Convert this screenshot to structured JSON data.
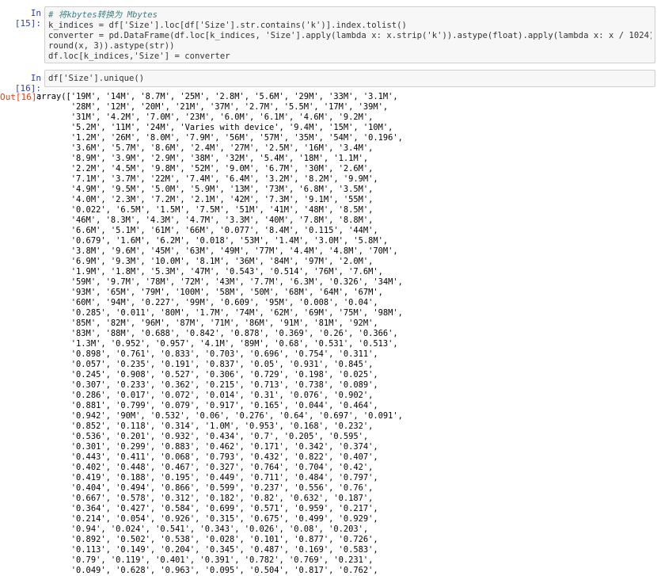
{
  "cells": {
    "c15": {
      "prompt": "In  [15]:",
      "lines": [
        {
          "text": "# 将kbytes转换为 Mbytes",
          "comment": true
        },
        {
          "text": "k_indices = df['Size'].loc[df['Size'].str.contains('k')].index.tolist()"
        },
        {
          "text": "converter = pd.DataFrame(df.loc[k_indices, 'Size'].apply(lambda x: x.strip('k')).astype(float).apply(lambda x: x / 1024).apply(lambda x:"
        },
        {
          "text": "round(x, 3)).astype(str))"
        },
        {
          "text": "df.loc[k_indices,'Size'] = converter"
        }
      ]
    },
    "c16": {
      "prompt": "In  [16]:",
      "code": "df['Size'].unique()",
      "out_prompt": "Out[16]:",
      "output_lines": [
        "array(['19M', '14M', '8.7M', '25M', '2.8M', '5.6M', '29M', '33M', '3.1M',",
        "       '28M', '12M', '20M', '21M', '37M', '2.7M', '5.5M', '17M', '39M',",
        "       '31M', '4.2M', '7.0M', '23M', '6.0M', '6.1M', '4.6M', '9.2M',",
        "       '5.2M', '11M', '24M', 'Varies with device', '9.4M', '15M', '10M',",
        "       '1.2M', '26M', '8.0M', '7.9M', '56M', '57M', '35M', '54M', '0.196',",
        "       '3.6M', '5.7M', '8.6M', '2.4M', '27M', '2.5M', '16M', '3.4M',",
        "       '8.9M', '3.9M', '2.9M', '38M', '32M', '5.4M', '18M', '1.1M',",
        "       '2.2M', '4.5M', '9.8M', '52M', '9.0M', '6.7M', '30M', '2.6M',",
        "       '7.1M', '3.7M', '22M', '7.4M', '6.4M', '3.2M', '8.2M', '9.9M',",
        "       '4.9M', '9.5M', '5.0M', '5.9M', '13M', '73M', '6.8M', '3.5M',",
        "       '4.0M', '2.3M', '7.2M', '2.1M', '42M', '7.3M', '9.1M', '55M',",
        "       '0.022', '6.5M', '1.5M', '7.5M', '51M', '41M', '48M', '8.5M',",
        "       '46M', '8.3M', '4.3M', '4.7M', '3.3M', '40M', '7.8M', '8.8M',",
        "       '6.6M', '5.1M', '61M', '66M', '0.077', '8.4M', '0.115', '44M',",
        "       '0.679', '1.6M', '6.2M', '0.018', '53M', '1.4M', '3.0M', '5.8M',",
        "       '3.8M', '9.6M', '45M', '63M', '49M', '77M', '4.4M', '4.8M', '70M',",
        "       '6.9M', '9.3M', '10.0M', '8.1M', '36M', '84M', '97M', '2.0M',",
        "       '1.9M', '1.8M', '5.3M', '47M', '0.543', '0.514', '76M', '7.6M',",
        "       '59M', '9.7M', '78M', '72M', '43M', '7.7M', '6.3M', '0.326', '34M',",
        "       '93M', '65M', '79M', '100M', '58M', '50M', '68M', '64M', '67M',",
        "       '60M', '94M', '0.227', '99M', '0.609', '95M', '0.008', '0.04',",
        "       '0.285', '0.011', '80M', '1.7M', '74M', '62M', '69M', '75M', '98M',",
        "       '85M', '82M', '96M', '87M', '71M', '86M', '91M', '81M', '92M',",
        "       '83M', '88M', '0.688', '0.842', '0.878', '0.369', '0.26', '0.366',",
        "       '1.3M', '0.952', '0.957', '4.1M', '89M', '0.68', '0.531', '0.513',",
        "       '0.898', '0.761', '0.833', '0.703', '0.696', '0.754', '0.311',",
        "       '0.057', '0.235', '0.191', '0.837', '0.05', '0.931', '0.845',",
        "       '0.245', '0.908', '0.527', '0.306', '0.729', '0.198', '0.025',",
        "       '0.307', '0.233', '0.362', '0.215', '0.713', '0.738', '0.089',",
        "       '0.286', '0.017', '0.072', '0.014', '0.31', '0.076', '0.902',",
        "       '0.881', '0.799', '0.079', '0.917', '0.165', '0.044', '0.464',",
        "       '0.942', '90M', '0.532', '0.06', '0.276', '0.64', '0.697', '0.091',",
        "       '0.852', '0.118', '0.314', '1.0M', '0.953', '0.168', '0.232',",
        "       '0.536', '0.201', '0.932', '0.434', '0.7', '0.205', '0.595',",
        "       '0.301', '0.299', '0.883', '0.462', '0.171', '0.342', '0.374',",
        "       '0.443', '0.411', '0.068', '0.793', '0.432', '0.822', '0.407',",
        "       '0.402', '0.448', '0.467', '0.327', '0.764', '0.704', '0.42',",
        "       '0.419', '0.188', '0.195', '0.449', '0.711', '0.484', '0.797',",
        "       '0.404', '0.494', '0.866', '0.599', '0.237', '0.556', '0.76',",
        "       '0.667', '0.578', '0.312', '0.182', '0.82', '0.632', '0.187',",
        "       '0.364', '0.427', '0.584', '0.699', '0.571', '0.959', '0.217',",
        "       '0.214', '0.054', '0.926', '0.315', '0.675', '0.499', '0.929',",
        "       '0.94', '0.024', '0.541', '0.343', '0.026', '0.08', '0.203',",
        "       '0.892', '0.502', '0.538', '0.028', '0.101', '0.877', '0.726',",
        "       '0.113', '0.149', '0.204', '0.345', '0.487', '0.169', '0.583',",
        "       '0.79', '0.119', '0.401', '0.391', '0.782', '0.769', '0.231',",
        "       '0.049', '0.628', '0.963', '0.095', '0.504', '0.817', '0.762',"
      ]
    }
  },
  "colors": {
    "in_prompt": "#303f9f",
    "out_prompt": "#d84315",
    "input_bg": "#f7f7f7",
    "comment": "#408080"
  }
}
